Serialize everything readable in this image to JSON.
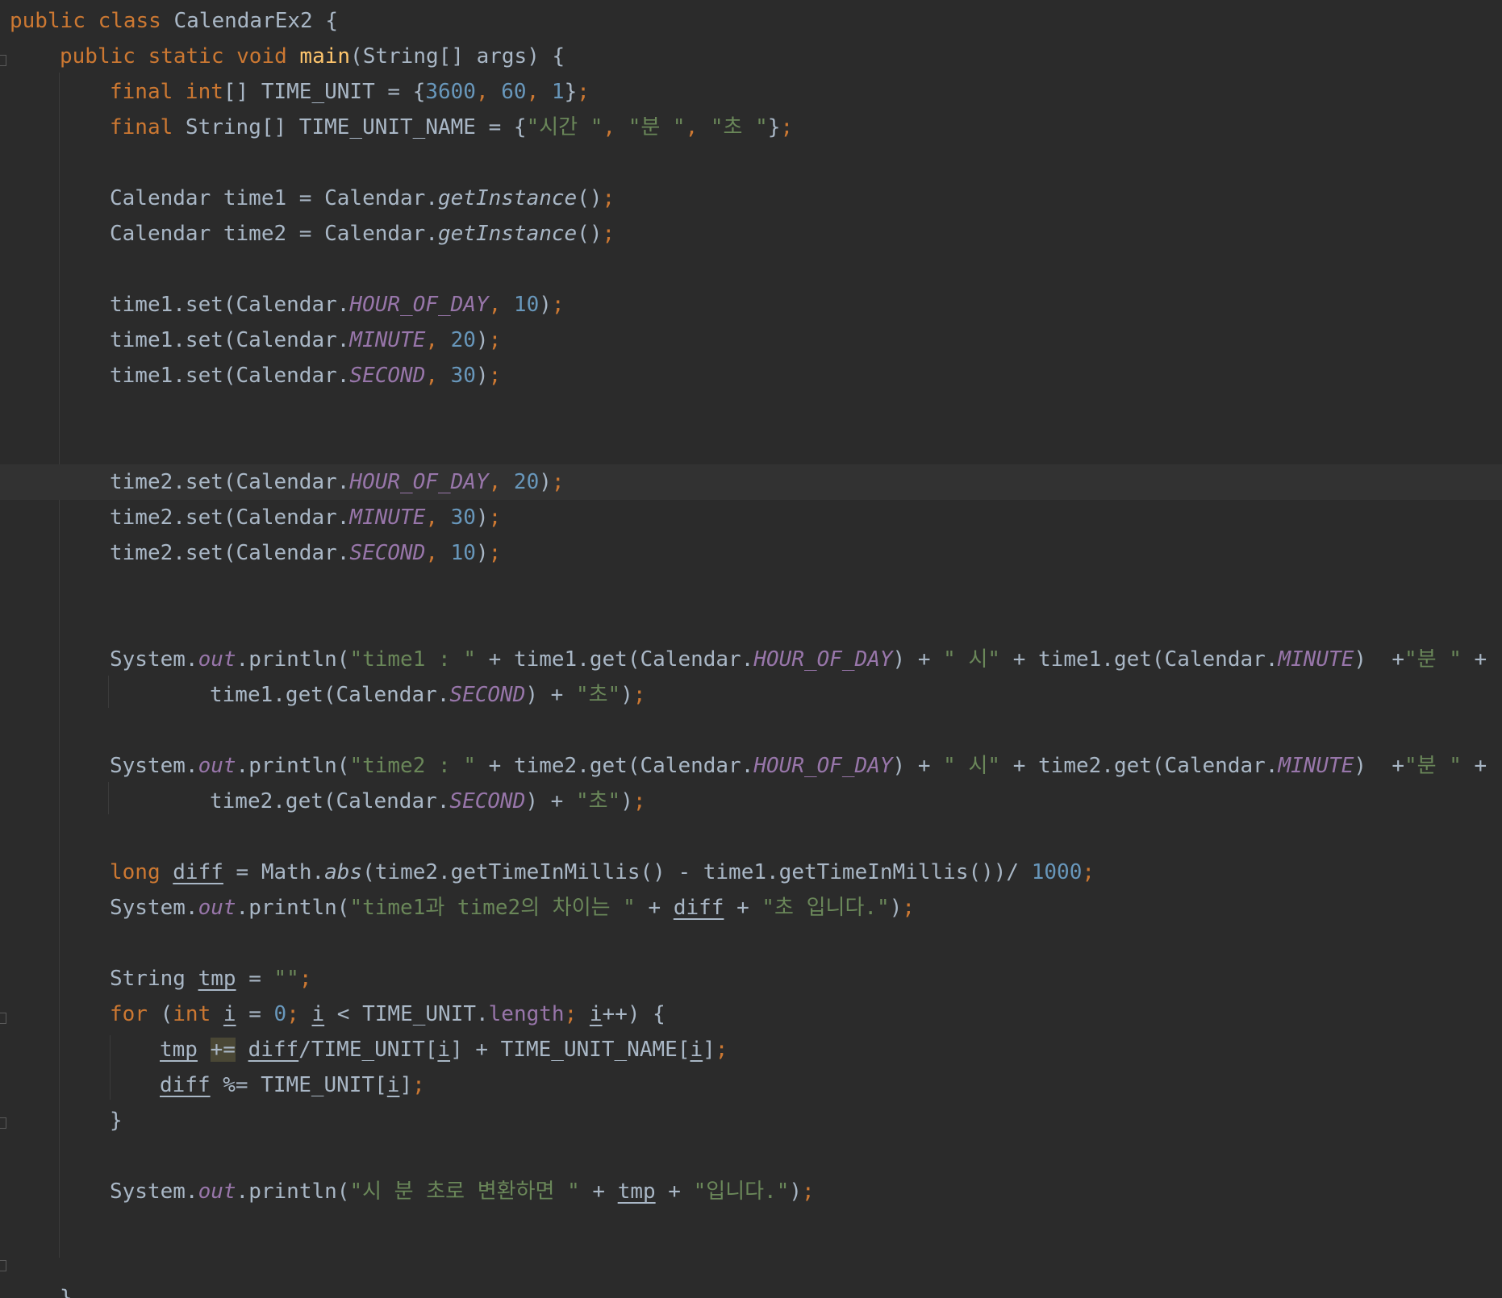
{
  "editor": {
    "lines": [
      [
        [
          "kw",
          "public class "
        ],
        [
          "pl",
          "CalendarEx2 {"
        ]
      ],
      [
        [
          "kw",
          "public static void "
        ],
        [
          "fn",
          "main"
        ],
        [
          "pl",
          "(String[] args) {"
        ]
      ],
      [
        [
          "kw",
          "final int"
        ],
        [
          "pl",
          "[] TIME_UNIT = {"
        ],
        [
          "num",
          "3600"
        ],
        [
          "pu",
          ", "
        ],
        [
          "num",
          "60"
        ],
        [
          "pu",
          ", "
        ],
        [
          "num",
          "1"
        ],
        [
          "pl",
          "}"
        ],
        [
          "pu",
          ";"
        ]
      ],
      [
        [
          "kw",
          "final "
        ],
        [
          "pl",
          "String[] TIME_UNIT_NAME = {"
        ],
        [
          "str",
          "\"시간 \""
        ],
        [
          "pu",
          ", "
        ],
        [
          "str",
          "\"분 \""
        ],
        [
          "pu",
          ", "
        ],
        [
          "str",
          "\"초 \""
        ],
        [
          "pl",
          "}"
        ],
        [
          "pu",
          ";"
        ]
      ],
      [],
      [
        [
          "pl",
          "Calendar time1 = Calendar."
        ],
        [
          "st",
          "getInstance"
        ],
        [
          "pl",
          "()"
        ],
        [
          "pu",
          ";"
        ]
      ],
      [
        [
          "pl",
          "Calendar time2 = Calendar."
        ],
        [
          "st",
          "getInstance"
        ],
        [
          "pl",
          "()"
        ],
        [
          "pu",
          ";"
        ]
      ],
      [],
      [
        [
          "pl",
          "time1.set(Calendar."
        ],
        [
          "con",
          "HOUR_OF_DAY"
        ],
        [
          "pu",
          ", "
        ],
        [
          "num",
          "10"
        ],
        [
          "pl",
          ")"
        ],
        [
          "pu",
          ";"
        ]
      ],
      [
        [
          "pl",
          "time1.set(Calendar."
        ],
        [
          "con",
          "MINUTE"
        ],
        [
          "pu",
          ", "
        ],
        [
          "num",
          "20"
        ],
        [
          "pl",
          ")"
        ],
        [
          "pu",
          ";"
        ]
      ],
      [
        [
          "pl",
          "time1.set(Calendar."
        ],
        [
          "con",
          "SECOND"
        ],
        [
          "pu",
          ", "
        ],
        [
          "num",
          "30"
        ],
        [
          "pl",
          ")"
        ],
        [
          "pu",
          ";"
        ]
      ],
      [],
      [],
      [
        [
          "pl",
          "time2.set(Calendar."
        ],
        [
          "con",
          "HOUR_OF_DAY"
        ],
        [
          "pu",
          ", "
        ],
        [
          "num",
          "20"
        ],
        [
          "pl",
          ")"
        ],
        [
          "pu",
          ";"
        ]
      ],
      [
        [
          "pl",
          "time2.set(Calendar."
        ],
        [
          "con",
          "MINUTE"
        ],
        [
          "pu",
          ", "
        ],
        [
          "num",
          "30"
        ],
        [
          "pl",
          ")"
        ],
        [
          "pu",
          ";"
        ]
      ],
      [
        [
          "pl",
          "time2.set(Calendar."
        ],
        [
          "con",
          "SECOND"
        ],
        [
          "pu",
          ", "
        ],
        [
          "num",
          "10"
        ],
        [
          "pl",
          ")"
        ],
        [
          "pu",
          ";"
        ]
      ],
      [],
      [],
      [
        [
          "pl",
          "System."
        ],
        [
          "con",
          "out"
        ],
        [
          "pl",
          ".println("
        ],
        [
          "str",
          "\"time1 : \""
        ],
        [
          "pl",
          " + time1.get(Calendar."
        ],
        [
          "con",
          "HOUR_OF_DAY"
        ],
        [
          "pl",
          ") + "
        ],
        [
          "str",
          "\" 시\""
        ],
        [
          "pl",
          " + time1.get(Calendar."
        ],
        [
          "con",
          "MINUTE"
        ],
        [
          "pl",
          ")  +"
        ],
        [
          "str",
          "\"분 \""
        ],
        [
          "pl",
          " +"
        ]
      ],
      [
        [
          "pl",
          "time1.get(Calendar."
        ],
        [
          "con",
          "SECOND"
        ],
        [
          "pl",
          ") + "
        ],
        [
          "str",
          "\"초\""
        ],
        [
          "pl",
          ")"
        ],
        [
          "pu",
          ";"
        ]
      ],
      [],
      [
        [
          "pl",
          "System."
        ],
        [
          "con",
          "out"
        ],
        [
          "pl",
          ".println("
        ],
        [
          "str",
          "\"time2 : \""
        ],
        [
          "pl",
          " + time2.get(Calendar."
        ],
        [
          "con",
          "HOUR_OF_DAY"
        ],
        [
          "pl",
          ") + "
        ],
        [
          "str",
          "\" 시\""
        ],
        [
          "pl",
          " + time2.get(Calendar."
        ],
        [
          "con",
          "MINUTE"
        ],
        [
          "pl",
          ")  +"
        ],
        [
          "str",
          "\"분 \""
        ],
        [
          "pl",
          " +"
        ]
      ],
      [
        [
          "pl",
          "time2.get(Calendar."
        ],
        [
          "con",
          "SECOND"
        ],
        [
          "pl",
          ") + "
        ],
        [
          "str",
          "\"초\""
        ],
        [
          "pl",
          ")"
        ],
        [
          "pu",
          ";"
        ]
      ],
      [],
      [
        [
          "kw",
          "long "
        ],
        [
          "u",
          "diff"
        ],
        [
          "pl",
          " = Math."
        ],
        [
          "st",
          "abs"
        ],
        [
          "pl",
          "(time2.getTimeInMillis() - time1.getTimeInMillis())/ "
        ],
        [
          "num",
          "1000"
        ],
        [
          "pu",
          ";"
        ]
      ],
      [
        [
          "pl",
          "System."
        ],
        [
          "con",
          "out"
        ],
        [
          "pl",
          ".println("
        ],
        [
          "str",
          "\"time1과 time2의 차이는 \""
        ],
        [
          "pl",
          " + "
        ],
        [
          "u",
          "diff"
        ],
        [
          "pl",
          " + "
        ],
        [
          "str",
          "\"초 입니다.\""
        ],
        [
          "pl",
          ")"
        ],
        [
          "pu",
          ";"
        ]
      ],
      [],
      [
        [
          "pl",
          "String "
        ],
        [
          "u",
          "tmp"
        ],
        [
          "pl",
          " = "
        ],
        [
          "str",
          "\"\""
        ],
        [
          "pu",
          ";"
        ]
      ],
      [
        [
          "kw",
          "for "
        ],
        [
          "pl",
          "("
        ],
        [
          "kw",
          "int "
        ],
        [
          "u",
          "i"
        ],
        [
          "pl",
          " = "
        ],
        [
          "num",
          "0"
        ],
        [
          "pu",
          "; "
        ],
        [
          "u",
          "i"
        ],
        [
          "pl",
          " < TIME_UNIT."
        ],
        [
          "fld",
          "length"
        ],
        [
          "pu",
          "; "
        ],
        [
          "u",
          "i"
        ],
        [
          "pl",
          "++) {"
        ]
      ],
      [
        [
          "u",
          "tmp"
        ],
        [
          "pl",
          " "
        ],
        [
          "hl",
          "+="
        ],
        [
          "pl",
          " "
        ],
        [
          "u",
          "diff"
        ],
        [
          "pl",
          "/TIME_UNIT["
        ],
        [
          "u",
          "i"
        ],
        [
          "pl",
          "] + TIME_UNIT_NAME["
        ],
        [
          "u",
          "i"
        ],
        [
          "pl",
          "]"
        ],
        [
          "pu",
          ";"
        ]
      ],
      [
        [
          "u",
          "diff"
        ],
        [
          "pl",
          " %= TIME_UNIT["
        ],
        [
          "u",
          "i"
        ],
        [
          "pl",
          "]"
        ],
        [
          "pu",
          ";"
        ]
      ],
      [
        [
          "pl",
          "}"
        ]
      ],
      [],
      [
        [
          "pl",
          "System."
        ],
        [
          "con",
          "out"
        ],
        [
          "pl",
          ".println("
        ],
        [
          "str",
          "\"시 분 초로 변환하면 \""
        ],
        [
          "pl",
          " + "
        ],
        [
          "u",
          "tmp"
        ],
        [
          "pl",
          " + "
        ],
        [
          "str",
          "\"입니다.\""
        ],
        [
          "pl",
          ")"
        ],
        [
          "pu",
          ";"
        ]
      ],
      [],
      [],
      [
        [
          "pl",
          "}"
        ]
      ],
      [
        [
          "pl",
          "}"
        ]
      ]
    ]
  }
}
